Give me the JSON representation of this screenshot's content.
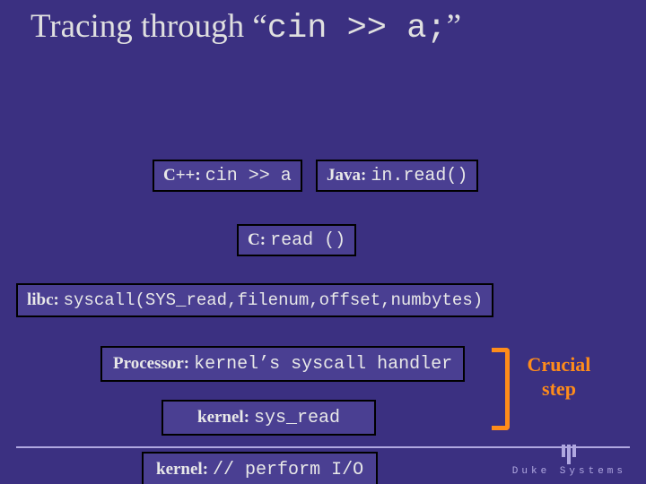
{
  "title": {
    "prefix": "Tracing through “",
    "code": "cin >> a;",
    "suffix": "”"
  },
  "boxes": {
    "cpp": {
      "label": "C++:",
      "code": "cin >> a"
    },
    "java": {
      "label": "Java:",
      "code": "in.read()"
    },
    "c": {
      "label": "C:",
      "code": "read ()"
    },
    "libc": {
      "label": "libc:",
      "code": "syscall(SYS_read,filenum,offset,numbytes)"
    },
    "proc": {
      "label": "Processor:",
      "code": "kernel’s syscall handler"
    },
    "k1": {
      "label": "kernel:",
      "code": "sys_read"
    },
    "k2": {
      "label": "kernel:",
      "code": "// perform I/O"
    }
  },
  "annotation": {
    "line1": "Crucial",
    "line2": "step"
  },
  "footer": {
    "brand": "Duke Systems"
  }
}
